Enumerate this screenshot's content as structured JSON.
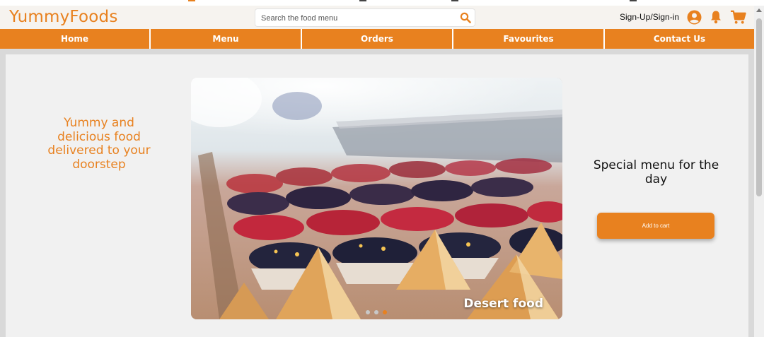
{
  "brand": {
    "name": "YummyFoods",
    "accent": "#e8811f"
  },
  "search": {
    "placeholder": "Search the food menu",
    "value": ""
  },
  "header": {
    "signin_label": "Sign-Up/Sign-in"
  },
  "nav": {
    "items": [
      {
        "label": "Home"
      },
      {
        "label": "Menu"
      },
      {
        "label": "Orders"
      },
      {
        "label": "Favourites"
      },
      {
        "label": "Contact Us"
      }
    ]
  },
  "hero": {
    "tagline": "Yummy and delicious food delivered to your doorstep",
    "carousel": {
      "caption": "Desert food",
      "slide_count": 3,
      "active_slide": 3
    },
    "special_title": "Special menu for the day",
    "add_to_cart_label": "Add to cart"
  },
  "icons": {
    "search": "search-icon",
    "account": "user-icon",
    "notifications": "bell-icon",
    "cart": "cart-icon"
  }
}
